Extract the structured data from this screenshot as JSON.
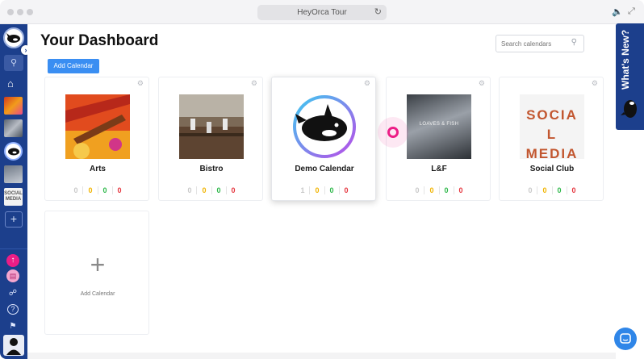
{
  "window": {
    "url_title": "HeyOrca Tour",
    "reload_icon": "reload-icon",
    "right_icons": [
      "volume-icon",
      "fullscreen-icon"
    ]
  },
  "sidebar": {
    "toggle_icon": "chevron-right-icon",
    "search_icon": "search-icon",
    "home_icon": "home-icon",
    "add_icon": "plus-icon",
    "calendar_thumbs": [
      "Arts",
      "Bistro",
      "Demo Calendar",
      "L&F",
      "Social Club"
    ],
    "social_thumb_text": "SOCIAL MEDIA",
    "bottom_icons": [
      "upload-icon",
      "inbox-icon",
      "share-icon",
      "help-icon",
      "bell-icon"
    ]
  },
  "header": {
    "title": "Your Dashboard",
    "add_button": "Add Calendar",
    "search_placeholder": "Search calendars"
  },
  "calendars": [
    {
      "name": "Arts",
      "counts": [
        "0",
        "0",
        "0",
        "0"
      ]
    },
    {
      "name": "Bistro",
      "counts": [
        "0",
        "0",
        "0",
        "0"
      ]
    },
    {
      "name": "Demo Calendar",
      "counts": [
        "1",
        "0",
        "0",
        "0"
      ]
    },
    {
      "name": "L&F",
      "counts": [
        "0",
        "0",
        "0",
        "0"
      ],
      "image_text": "LOAVES & FISH"
    },
    {
      "name": "Social Club",
      "counts": [
        "0",
        "0",
        "0",
        "0"
      ],
      "image_text": "SOCIAL MEDIA"
    }
  ],
  "add_card": {
    "label": "Add Calendar"
  },
  "whats_new": {
    "label": "What's New?"
  },
  "colors": {
    "sidebar": "#1c3f8c",
    "primary_button": "#3a8ef2",
    "accent_pink": "#ec1d86",
    "count_gray": "#c9c9c9",
    "count_yellow": "#f1b400",
    "count_green": "#2eb84a",
    "count_red": "#e5343d"
  }
}
